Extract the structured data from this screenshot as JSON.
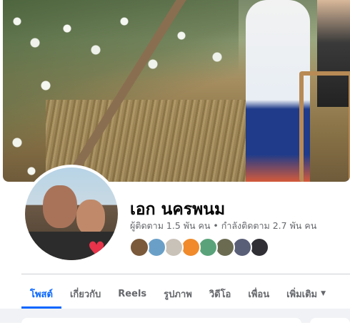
{
  "profile": {
    "name": "เอก นครพนม",
    "followers_text": "ผู้ติดตาม 1.5 พัน คน",
    "separator": "•",
    "following_text": "กำลังติดตาม 2.7 พัน คน",
    "friend_avatar_colors": [
      "#7a5a3a",
      "#6aa0c8",
      "#c9c2b8",
      "#f08a2a",
      "#5aa37a",
      "#6b6b52",
      "#5a5f78",
      "#2f2f35"
    ]
  },
  "tabs": [
    {
      "label": "โพสต์",
      "active": true
    },
    {
      "label": "เกี่ยวกับ",
      "active": false
    },
    {
      "label": "Reels",
      "active": false
    },
    {
      "label": "รูปภาพ",
      "active": false
    },
    {
      "label": "วิดีโอ",
      "active": false
    },
    {
      "label": "เพื่อน",
      "active": false
    },
    {
      "label": "เพิ่มเติม",
      "active": false,
      "icon": "caret-down-icon"
    }
  ],
  "colors": {
    "accent": "#0866ff",
    "text_primary": "#050505",
    "text_secondary": "#65676b",
    "background_alt": "#f0f2f5"
  }
}
